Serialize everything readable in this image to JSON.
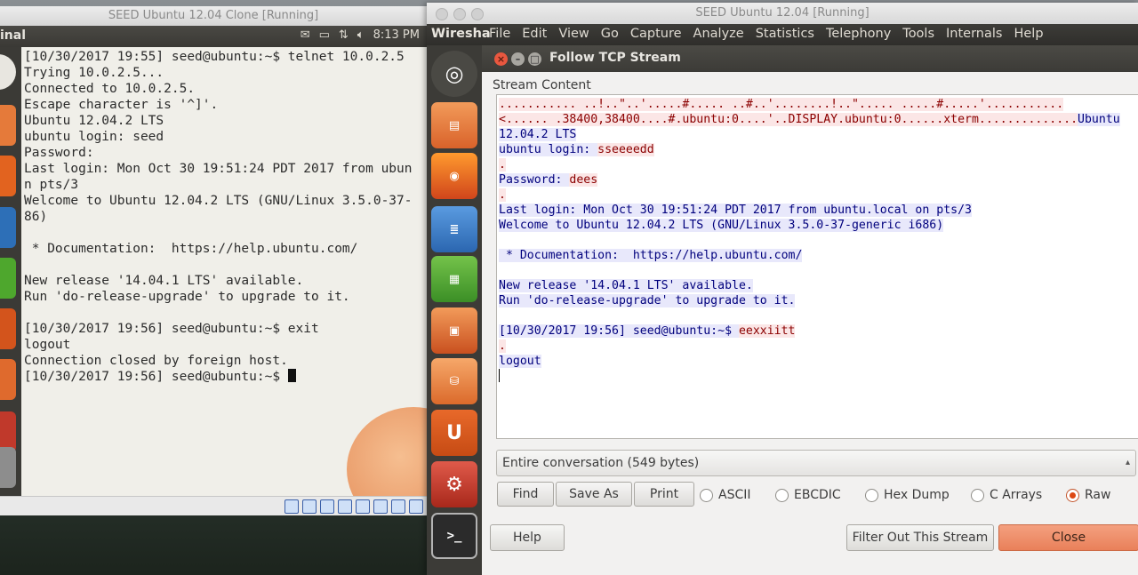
{
  "left_vm": {
    "title": "SEED Ubuntu 12.04 Clone [Running]",
    "panel": {
      "app_name": "inal",
      "clock": "8:13 PM"
    },
    "terminal_lines": [
      "[10/30/2017 19:55] seed@ubuntu:~$ telnet 10.0.2.5",
      "Trying 10.0.2.5...",
      "Connected to 10.0.2.5.",
      "Escape character is '^]'.",
      "Ubuntu 12.04.2 LTS",
      "ubuntu login: seed",
      "Password:",
      "Last login: Mon Oct 30 19:51:24 PDT 2017 from ubun",
      "n pts/3",
      "Welcome to Ubuntu 12.04.2 LTS (GNU/Linux 3.5.0-37-",
      "86)",
      "",
      " * Documentation:  https://help.ubuntu.com/",
      "",
      "New release '14.04.1 LTS' available.",
      "Run 'do-release-upgrade' to upgrade to it.",
      "",
      "[10/30/2017 19:56] seed@ubuntu:~$ exit",
      "logout",
      "Connection closed by foreign host.",
      "[10/30/2017 19:56] seed@ubuntu:~$ "
    ]
  },
  "right_vm": {
    "title": "SEED Ubuntu 12.04 [Running]",
    "menubar": {
      "app": "Wiresha",
      "items": [
        "File",
        "Edit",
        "View",
        "Go",
        "Capture",
        "Analyze",
        "Statistics",
        "Telephony",
        "Tools",
        "Internals",
        "Help"
      ]
    }
  },
  "dialog": {
    "title": "Follow TCP Stream",
    "section_label": "Stream Content",
    "stream": {
      "line1": "........... ..!..\"..'.....#..... ..#..'........!..\"..... .....#.....'...........",
      "line2_cli": "<...... .38400,38400....#.ubuntu:0....'..DISPLAY.ubuntu:0......xterm..............",
      "line2_srv": "Ubuntu",
      "line3": "12.04.2 LTS",
      "login_prompt": "ubuntu login: ",
      "login_typed": "sseeeedd",
      "dot": ".",
      "password_prompt": "Password: ",
      "password_typed": "dees",
      "last_login": "Last login: Mon Oct 30 19:51:24 PDT 2017 from ubuntu.local on pts/3",
      "welcome": "Welcome to Ubuntu 12.04.2 LTS (GNU/Linux 3.5.0-37-generic i686)",
      "docs": " * Documentation:  https://help.ubuntu.com/",
      "release": "New release '14.04.1 LTS' available.",
      "upgrade": "Run 'do-release-upgrade' to upgrade to it.",
      "prompt": "[10/30/2017 19:56] seed@ubuntu:~$ ",
      "exit_typed": "eexxiitt",
      "logout": "logout"
    },
    "conversation_select": "Entire conversation (549 bytes)",
    "buttons": {
      "find": "Find",
      "save_as": "Save As",
      "print": "Print",
      "help": "Help",
      "filter_out": "Filter Out This Stream",
      "close": "Close"
    },
    "format_options": [
      "ASCII",
      "EBCDIC",
      "Hex Dump",
      "C Arrays",
      "Raw"
    ],
    "selected_format": "Raw"
  }
}
